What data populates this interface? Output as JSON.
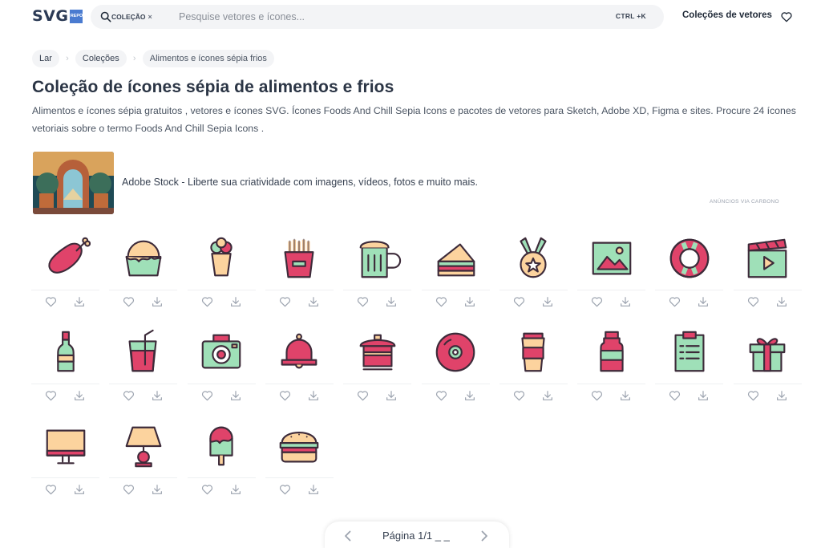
{
  "header": {
    "logo_text": "SVG",
    "logo_box": "REPO",
    "search_chip": "COLEÇÃO",
    "search_chip_close": "×",
    "search_placeholder": "Pesquise vetores e ícones...",
    "shortcut": "CTRL +K",
    "nav_collections": "Coleções de vetores"
  },
  "breadcrumb": [
    "Lar",
    "Coleções",
    "Alimentos e ícones sépia frios"
  ],
  "page": {
    "title": "Coleção de ícones sépia de alimentos e frios",
    "description": "Alimentos e ícones sépia gratuitos , vetores e ícones SVG. Ícones Foods And Chill Sepia Icons e pacotes de vetores para Sketch, Adobe XD, Figma e sites. Procure 24 ícones vetoriais sobre o termo Foods And Chill Sepia Icons ."
  },
  "ad": {
    "text": "Adobe Stock - Liberte sua criatividade com imagens, vídeos, fotos e muito mais.",
    "via": "ANÚNCIOS VIA CARBONO"
  },
  "icons": [
    {
      "name": "chicken-leg-icon"
    },
    {
      "name": "cupcake-icon"
    },
    {
      "name": "ice-cream-cone-icon"
    },
    {
      "name": "french-fries-icon"
    },
    {
      "name": "beer-mug-icon"
    },
    {
      "name": "sandwich-icon"
    },
    {
      "name": "medal-icon"
    },
    {
      "name": "picture-icon"
    },
    {
      "name": "lifebuoy-icon"
    },
    {
      "name": "clapperboard-icon"
    },
    {
      "name": "bottle-icon"
    },
    {
      "name": "drink-glass-icon"
    },
    {
      "name": "camera-icon"
    },
    {
      "name": "bell-icon"
    },
    {
      "name": "cooking-pot-icon"
    },
    {
      "name": "disc-icon"
    },
    {
      "name": "coffee-cup-icon"
    },
    {
      "name": "jar-icon"
    },
    {
      "name": "clipboard-icon"
    },
    {
      "name": "gift-icon"
    },
    {
      "name": "monitor-icon"
    },
    {
      "name": "lamp-icon"
    },
    {
      "name": "popsicle-icon"
    },
    {
      "name": "burger-icon"
    }
  ],
  "pagination": {
    "label": "Página 1/1 _ _"
  },
  "colors": {
    "pink": "#e0436a",
    "green": "#9fe0b8",
    "peach": "#fcd39e",
    "outline": "#3d2b3a",
    "title": "#2b3545"
  }
}
